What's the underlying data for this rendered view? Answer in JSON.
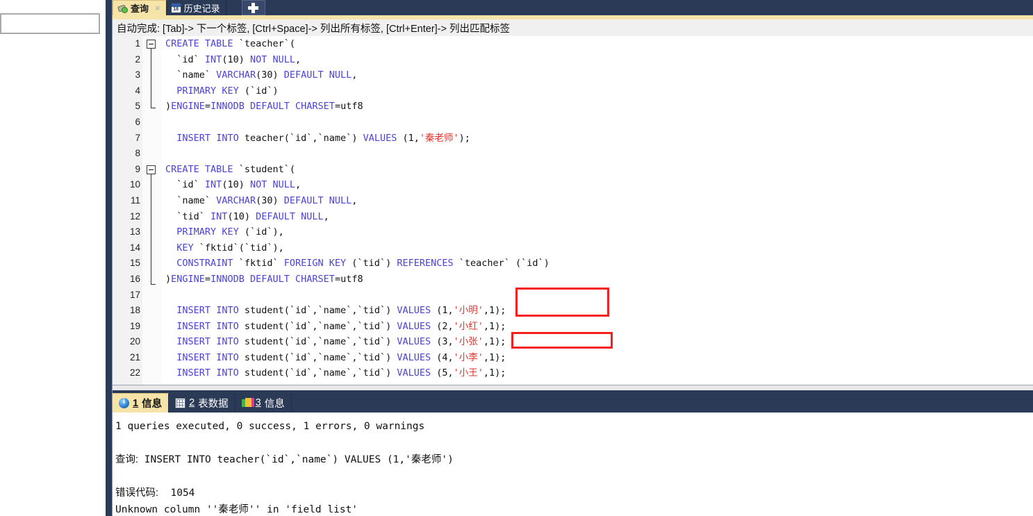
{
  "window": {
    "accent_navy": "#2b3a57",
    "accent_cream": "#f6e3a8",
    "annotation_color": "#f51f1f"
  },
  "left_pane": {
    "field_value": "",
    "field_placeholder": ""
  },
  "tabs": {
    "items": [
      {
        "label": "查询",
        "icon": "query-icon",
        "active": true,
        "close": "×"
      },
      {
        "label": "历史记录",
        "icon": "calendar-icon",
        "active": false,
        "close": ""
      }
    ],
    "new_tab_label": "+"
  },
  "hint_bar": {
    "text": "自动完成: [Tab]-> 下一个标签, [Ctrl+Space]-> 列出所有标签, [Ctrl+Enter]-> 列出匹配标签"
  },
  "editor": {
    "lines": [
      {
        "n": "1",
        "text": "CREATE TABLE `teacher`("
      },
      {
        "n": "2",
        "text": "  `id` INT(10) NOT NULL,"
      },
      {
        "n": "3",
        "text": "  `name` VARCHAR(30) DEFAULT NULL,"
      },
      {
        "n": "4",
        "text": "  PRIMARY KEY (`id`)"
      },
      {
        "n": "5",
        "text": ")ENGINE=INNODB DEFAULT CHARSET=utf8"
      },
      {
        "n": "6",
        "text": ""
      },
      {
        "n": "7",
        "text": "  INSERT INTO teacher(`id`,`name`) VALUES (1,'秦老师');"
      },
      {
        "n": "8",
        "text": ""
      },
      {
        "n": "9",
        "text": "CREATE TABLE `student`("
      },
      {
        "n": "10",
        "text": "  `id` INT(10) NOT NULL,"
      },
      {
        "n": "11",
        "text": "  `name` VARCHAR(30) DEFAULT NULL,"
      },
      {
        "n": "12",
        "text": "  `tid` INT(10) DEFAULT NULL,"
      },
      {
        "n": "13",
        "text": "  PRIMARY KEY (`id`),"
      },
      {
        "n": "14",
        "text": "  KEY `fktid`(`tid`),"
      },
      {
        "n": "15",
        "text": "  CONSTRAINT `fktid` FOREIGN KEY (`tid`) REFERENCES `teacher` (`id`)"
      },
      {
        "n": "16",
        "text": ")ENGINE=INNODB DEFAULT CHARSET=utf8"
      },
      {
        "n": "17",
        "text": ""
      },
      {
        "n": "18",
        "text": "  INSERT INTO student(`id`,`name`,`tid`) VALUES (1,'小明',1);"
      },
      {
        "n": "19",
        "text": "  INSERT INTO student(`id`,`name`,`tid`) VALUES (2,'小红',1);"
      },
      {
        "n": "20",
        "text": "  INSERT INTO student(`id`,`name`,`tid`) VALUES (3,'小张',1);"
      },
      {
        "n": "21",
        "text": "  INSERT INTO student(`id`,`name`,`tid`) VALUES (4,'小李',1);"
      },
      {
        "n": "22",
        "text": "  INSERT INTO student(`id`,`name`,`tid`) VALUES (5,'小王',1);"
      }
    ]
  },
  "result_tabs": {
    "items": [
      {
        "num": "1",
        "label": "信息",
        "icon": "info-icon",
        "active": true
      },
      {
        "num": "2",
        "label": "表数据",
        "icon": "grid-icon",
        "active": false
      },
      {
        "num": "3",
        "label": "信息",
        "icon": "chart-icon",
        "active": false
      }
    ]
  },
  "messages": {
    "summary": "1 queries executed, 0 success, 1 errors, 0 warnings",
    "query_label": "查询:",
    "query_text": " INSERT INTO teacher(`id`,`name`) VALUES (1,'秦老师')",
    "error_label": "错误代码:",
    "error_code": "  1054",
    "error_detail": "Unknown column ''秦老师'' in 'field list'"
  }
}
